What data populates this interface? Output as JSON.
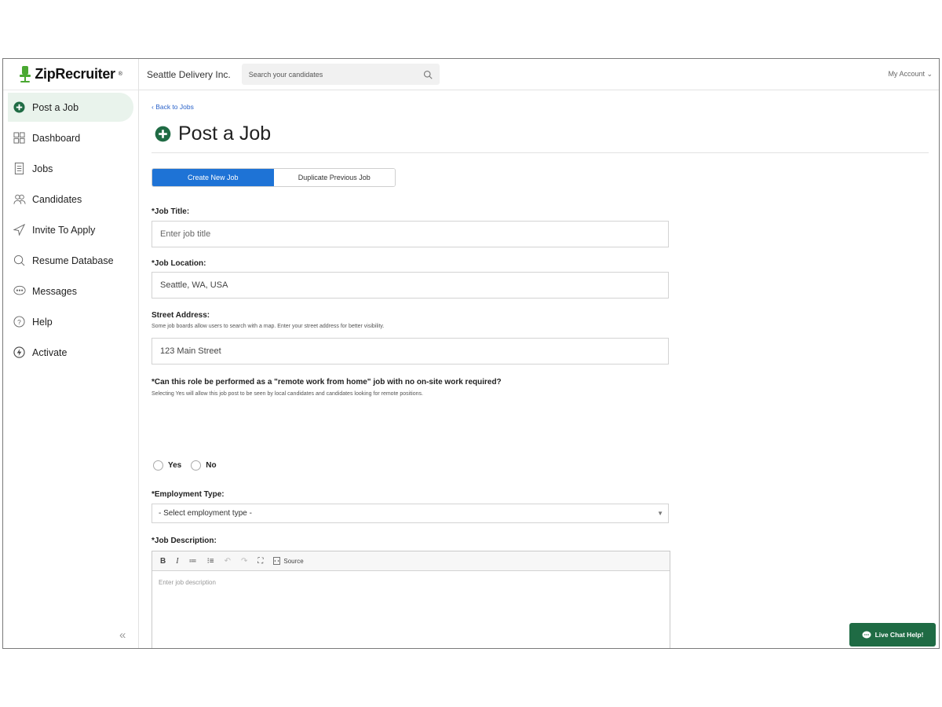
{
  "brand": {
    "name": "ZipRecruiter",
    "mark": "®",
    "accent": "#1f6b44",
    "logo_green": "#4aa832"
  },
  "sidebar": {
    "items": [
      {
        "label": "Post a Job",
        "icon": "plus-circle-icon",
        "active": true
      },
      {
        "label": "Dashboard",
        "icon": "grid-icon",
        "active": false
      },
      {
        "label": "Jobs",
        "icon": "document-icon",
        "active": false
      },
      {
        "label": "Candidates",
        "icon": "people-icon",
        "active": false
      },
      {
        "label": "Invite To Apply",
        "icon": "send-icon",
        "active": false
      },
      {
        "label": "Resume Database",
        "icon": "search-icon",
        "active": false
      },
      {
        "label": "Messages",
        "icon": "chat-bubble-icon",
        "active": false
      },
      {
        "label": "Help",
        "icon": "question-icon",
        "active": false
      },
      {
        "label": "Activate",
        "icon": "bolt-circle-icon",
        "active": false
      }
    ],
    "collapse_label": "«"
  },
  "topbar": {
    "company": "Seattle Delivery Inc.",
    "search_placeholder": "Search your candidates",
    "account": "My Account ⌄"
  },
  "main": {
    "back_link": "‹ Back to Jobs",
    "title": "Post a Job",
    "tabs": [
      {
        "label": "Create New Job",
        "active": true
      },
      {
        "label": "Duplicate Previous Job",
        "active": false
      }
    ],
    "job_title": {
      "label": "*Job Title:",
      "placeholder": "Enter job title",
      "value": ""
    },
    "job_location": {
      "label": "*Job Location:",
      "value": "Seattle, WA, USA"
    },
    "street_address": {
      "label": "Street Address:",
      "hint": "Some job boards allow users to search with a map. Enter your street address for better visibility.",
      "value": "123 Main Street"
    },
    "remote": {
      "label": "*Can this role be performed as a \"remote work from home\" job with no on-site work required?",
      "hint": "Selecting Yes will allow this job post to be seen by local candidates and candidates looking for remote positions.",
      "options": [
        "Yes",
        "No"
      ]
    },
    "employment_type": {
      "label": "*Employment Type:",
      "selected": "- Select employment type -"
    },
    "job_description": {
      "label": "*Job Description:",
      "toolbar": [
        "B",
        "I",
        "≔",
        "⁝≡",
        "↶",
        "↷",
        "⛶",
        "Source"
      ],
      "placeholder": "Enter job description"
    }
  },
  "chat_button": "Live Chat Help!"
}
